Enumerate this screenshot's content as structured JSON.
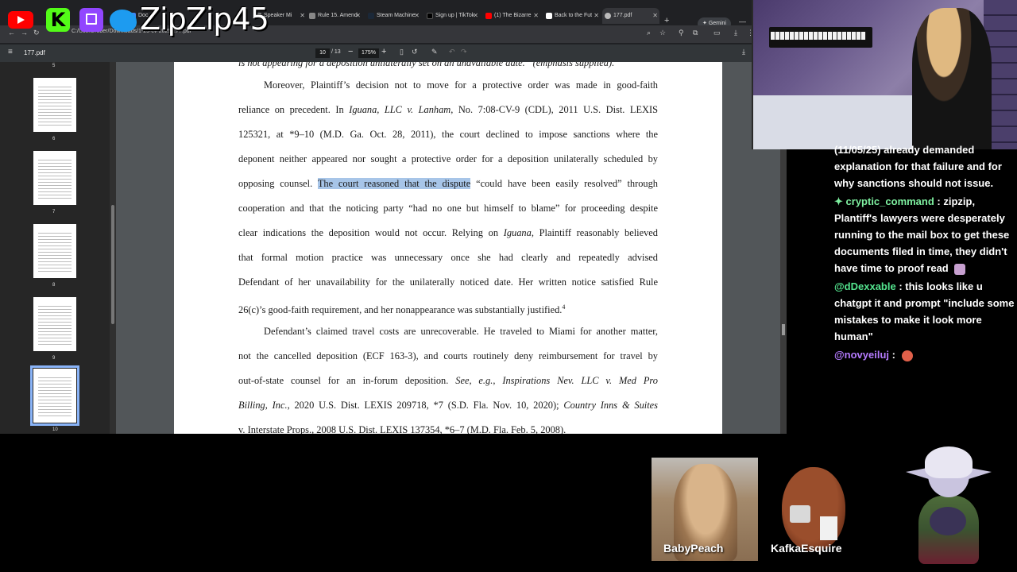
{
  "browser": {
    "tabs": [
      {
        "label": "Doc",
        "color": "#4285f4"
      },
      {
        "label": "Speaker Mi",
        "color": "#888888"
      },
      {
        "label": "Rule 15. Amend",
        "color": "#888888"
      },
      {
        "label": "Steam Machine",
        "color": "#1b2838"
      },
      {
        "label": "Sign up | TikTok",
        "color": "#000000"
      },
      {
        "label": "(1) The Bizarre",
        "color": "#ff0000"
      },
      {
        "label": "Back to the Fut",
        "color": "#ffffff"
      },
      {
        "label": "177.pdf",
        "color": "#bbbbbb",
        "active": true
      }
    ],
    "gemini_label": "Gemini",
    "url": "C:/Users/rober/Downloads/1-25-cv-2025/177.pdf"
  },
  "pdf": {
    "title": "177.pdf",
    "current_page": "10",
    "total_pages": "/ 13",
    "zoom": "175%",
    "thumbnails": [
      {
        "label": "5"
      },
      {
        "label": "6"
      },
      {
        "label": "7"
      },
      {
        "label": "8"
      },
      {
        "label": "9"
      },
      {
        "label": "10",
        "selected": true
      }
    ]
  },
  "document": {
    "top_line": "is not appearing for a deposition unilaterally set on an unavailable date.” (emphasis supplied).",
    "p1": [
      "Moreover, Plaintiff’s decision not to move for a protective order was made in good-faith",
      "reliance on precedent. In Iguana, LLC v. Lanham, No. 7:08-CV-9 (CDL), 2011 U.S. Dist. LEXIS",
      "125321, at *9–10 (M.D. Ga. Oct. 28, 2011), the court declined to impose sanctions where the",
      "deponent neither appeared nor sought a protective order for a deposition unilaterally scheduled by"
    ],
    "p1_line5_pre": "opposing counsel. ",
    "p1_line5_highlight": "The court reasoned that the dispute",
    "p1_line5_post": " “could have been easily resolved” through",
    "p1_rest": [
      "cooperation and that the noticing party “had no one but himself to blame” for proceeding despite"
    ],
    "p1_line7_pre": "clear indications the deposition would not occur. Relying on ",
    "p1_line7_italic": "Iguana",
    "p1_line7_post": ", Plaintiff reasonably believed",
    "p1_tail": [
      "that formal motion practice was unnecessary once she had clearly and repeatedly advised",
      "Defendant of her unavailability for the unilaterally noticed date. Her written notice satisfied Rule"
    ],
    "p1_last": "26(c)’s good-faith requirement, and her nonappearance was substantially justified.",
    "footnote_ref": "4",
    "p2": [
      "Defendant’s claimed travel costs are unrecoverable. He traveled to Miami for another matter,",
      "not the cancelled deposition (ECF 163-3), and courts routinely deny reimbursement for travel by"
    ],
    "p2_line3_pre": "out-of-state counsel for an in-forum deposition. ",
    "p2_line3_italic": "See, e.g., Inspirations Nev. LLC v. Med Pro",
    "p2_line4_italic": "Billing, Inc.",
    "p2_line4_mid": ", 2020 U.S. Dist. LEXIS 209718, *7 (S.D. Fla. Nov. 10, 2020); ",
    "p2_line4_italic2": "Country Inns & Suites",
    "p2_cutoff": "v. Interstate Props., 2008 U.S. Dist. LEXIS 137354, *6–7 (M.D. Fla. Feb. 5, 2008)."
  },
  "stream": {
    "channel_name": "ZipZip45",
    "brand_colors": {
      "youtube": "#ff0000",
      "kick": "#53fc18",
      "twitch": "#9146ff",
      "twitter": "#1d9bf0"
    }
  },
  "chat": {
    "partial": "(11/05/25) already demanded explanation for that failure and for why sanctions should not issue.",
    "messages": [
      {
        "user": "cryptic_command",
        "user_color": "#7ef0a0",
        "badge": "✦",
        "text": "zipzip, Plantiff's lawyers were desperately running to the mail box to get these documents filed in time, they didn't have time to proof read"
      },
      {
        "user": "@dDexxable",
        "user_color": "#54e58f",
        "text": "this looks like u chatgpt it and prompt \"include some mistakes to make it look more human\""
      },
      {
        "user": "@novyeiluj",
        "user_color": "#b57bff",
        "text": ""
      }
    ]
  },
  "avatars": [
    {
      "name": "BabyPeach"
    },
    {
      "name": "KafkaEsquire"
    }
  ]
}
